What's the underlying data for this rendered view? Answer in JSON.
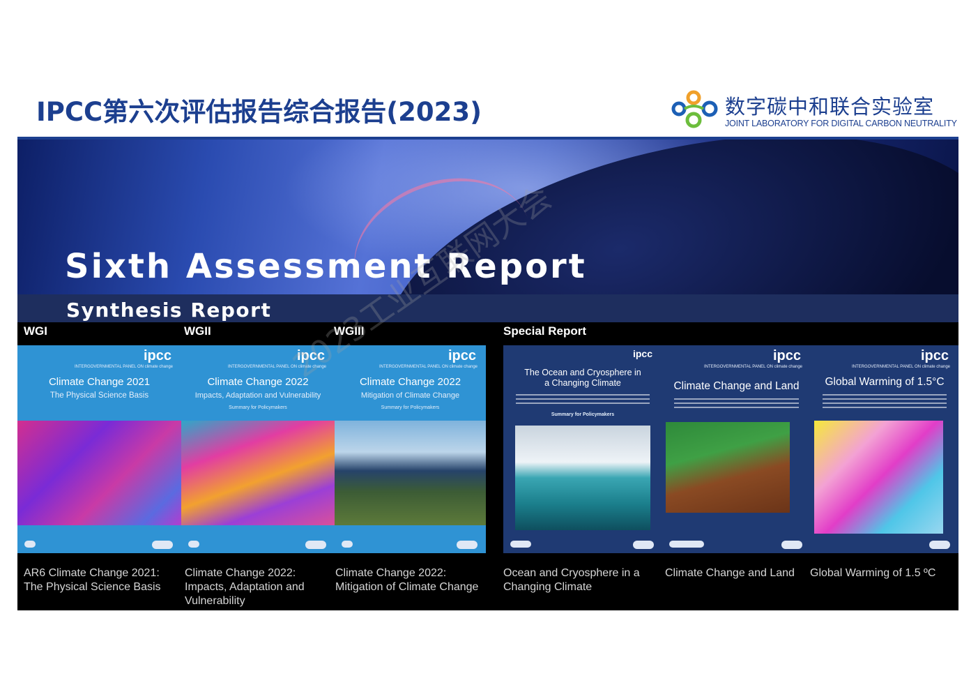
{
  "header": {
    "title": "IPCC第六次评估报告综合报告(2023)",
    "logo_cn": "数字碳中和联合实验室",
    "logo_en": "JOINT LABORATORY FOR DIGITAL CARBON NEUTRALITY"
  },
  "hero": {
    "title": "Sixth Assessment Report",
    "subtitle": "Synthesis Report"
  },
  "groups": {
    "wg1": "WGI",
    "wg2": "WGII",
    "wg3": "WGIII",
    "special": "Special Report"
  },
  "covers": [
    {
      "brand": "ipcc",
      "title": "Climate Change 2021",
      "subtitle": "The Physical Science Basis",
      "caption": "AR6 Climate Change 2021: The Physical Science Basis",
      "color": "#2f93d4"
    },
    {
      "brand": "ipcc",
      "title": "Climate Change 2022",
      "subtitle": "Impacts, Adaptation and Vulnerability",
      "note": "Summary for Policymakers",
      "caption": "Climate Change 2022: Impacts, Adaptation and Vulnerability",
      "color": "#2f93d4"
    },
    {
      "brand": "ipcc",
      "title": "Climate Change 2022",
      "subtitle": "Mitigation of Climate Change",
      "note": "Summary for Policymakers",
      "caption": "Climate Change 2022: Mitigation of Climate Change",
      "color": "#2f93d4"
    },
    {
      "brand": "ipcc",
      "title": "The Ocean and Cryosphere in a Changing Climate",
      "note": "Summary for Policymakers",
      "caption": "Ocean and Cryosphere in a Changing Climate",
      "color": "#1f3a73"
    },
    {
      "brand": "ipcc",
      "title": "Climate Change and Land",
      "caption": "Climate Change and Land",
      "color": "#1f3a73"
    },
    {
      "brand": "ipcc",
      "title": "Global Warming of 1.5°C",
      "caption": "Global Warming of 1.5 ºC",
      "color": "#1f3a73"
    }
  ],
  "watermark": "2023工业互联网大会"
}
